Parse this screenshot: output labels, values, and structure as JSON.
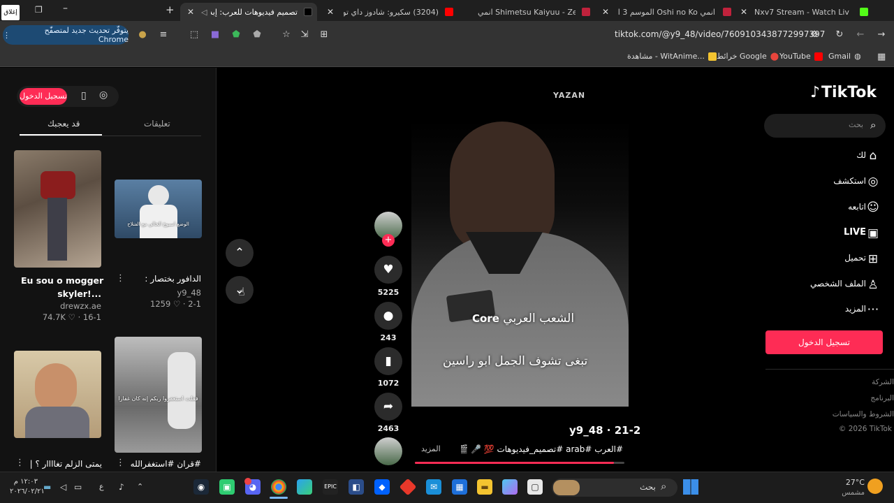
{
  "browser": {
    "tabs": [
      {
        "label": "Nxv7 Stream - Watch Live on Kick",
        "active": false
      },
      {
        "label": "انمي Oshi no Ko الموسم 3 الحلقة",
        "active": false
      },
      {
        "label": "انمي Shimetsu Kaiyuu - Zenpen",
        "active": false
      },
      {
        "label": "(3204) سكيرو: شادوز داي توايس",
        "active": false
      },
      {
        "label": "تصميم فيديوهات للعرب: إبداع",
        "active": true
      }
    ],
    "close_left": "إغلاق",
    "update_label": "يتوفّر تحديث جديد لمتصفّح Chrome",
    "url": "tiktok.com/@y9_48/video/7609103438772997397",
    "bookmarks": [
      "Gmail",
      "YouTube",
      "خرائط Google",
      "مشاهدة - WitAnime..."
    ]
  },
  "left": {
    "login_label": "تسجيل الدخول",
    "tabs": {
      "liked": "قد يعجبك",
      "comments": "تعليقات"
    },
    "videos": [
      {
        "title": "Eu sou o mogger",
        "title2": "skyler!...",
        "author": "drewzx.ae",
        "meta": "74.7K ♡ · 16-1"
      },
      {
        "title": "الدافور بختصار :",
        "author": "y9_48",
        "meta": "1259 ♡ · 2-1"
      },
      {
        "title": "يمتى الزلم تغاااار ؟ |",
        "author": "",
        "meta": ""
      },
      {
        "title": "#قران #استغفرالله",
        "author": "",
        "meta": ""
      }
    ],
    "thumb2_caption": "الوضع اسبوع الحالي مع الفتلاح",
    "thumb4_caption": "فقلت استغفروا ربكم إنه كان غفارا"
  },
  "video": {
    "watermark": "YAZAN",
    "caption1": "الشعب العربي",
    "caption1_tag": "Core",
    "caption2": "تبغى تشوف الجمل ابو راسين",
    "author": "y9_48 · 21-2",
    "description": "#العرب #arab #تصميم_فيديوهات 💯 🎤 🎬 ...",
    "more": "المزيد",
    "progress": 0.95
  },
  "actions": {
    "likes": "5225",
    "comments": "243",
    "saves": "1072",
    "shares": "2463"
  },
  "right": {
    "brand": "TikTok",
    "search_placeholder": "بحث",
    "nav": [
      "لك",
      "استكشف",
      "اتابعه",
      "LIVE",
      "تحميل",
      "الملف الشخصي",
      "المزيد"
    ],
    "login_label": "تسجيل الدخول",
    "footer": [
      "الشركة",
      "البرنامج",
      "الشروط والسياسات",
      "© 2026 TikTok"
    ]
  },
  "taskbar": {
    "weather_temp": "27°C",
    "weather_desc": "مشمس",
    "search": "بحث",
    "time": "١٢:٠٣ م",
    "date": "٢٠٢٦/٠٢/٢١",
    "lang": "ع"
  }
}
